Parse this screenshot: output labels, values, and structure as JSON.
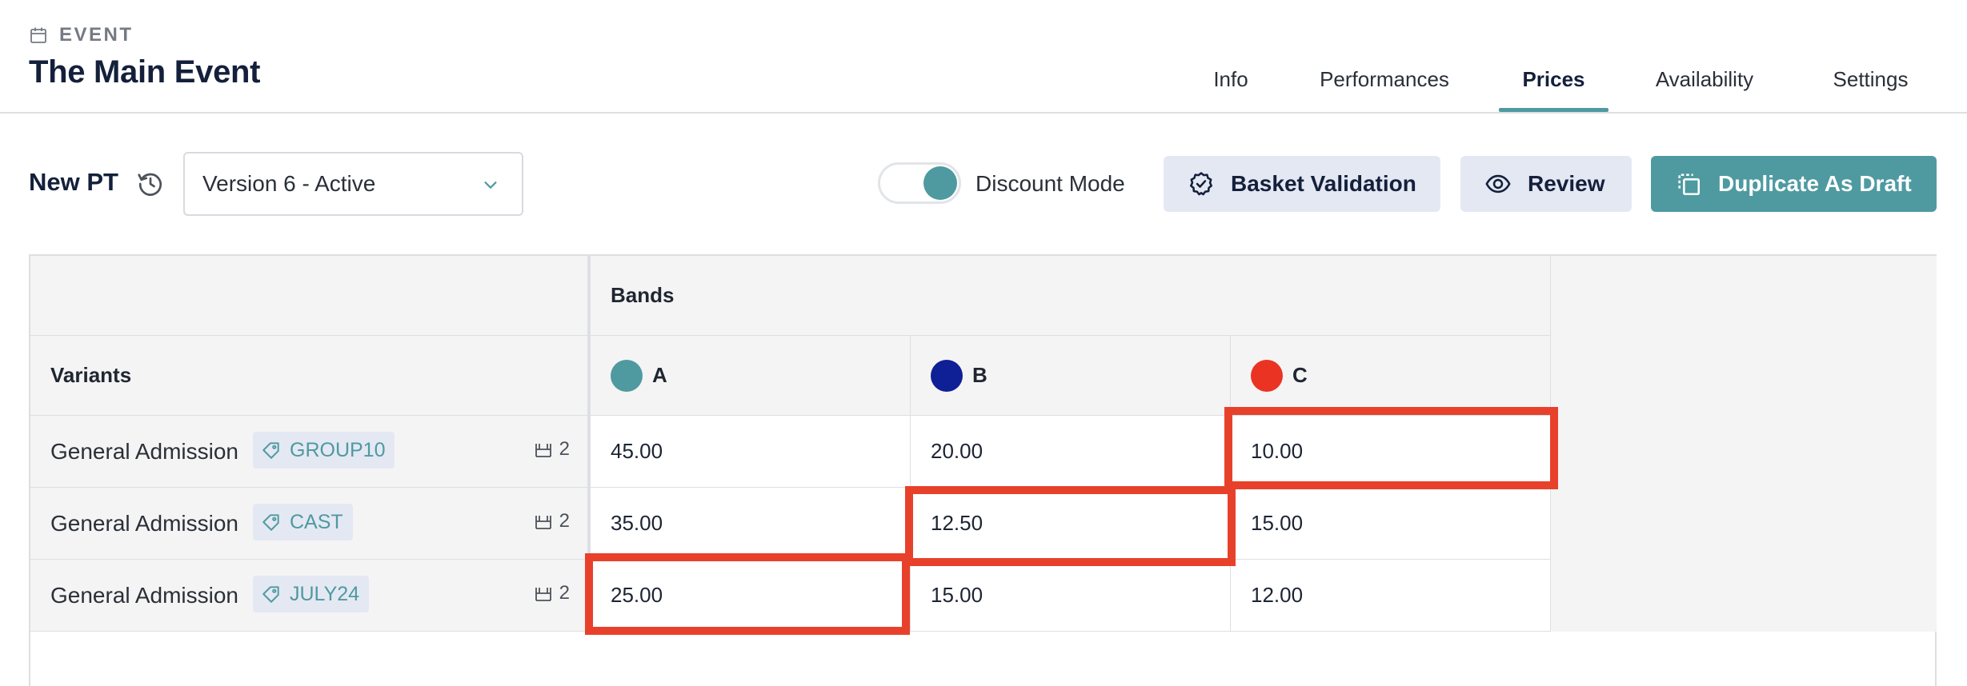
{
  "header": {
    "section_label": "EVENT",
    "title": "The Main Event",
    "tabs": [
      {
        "label": "Info",
        "active": false
      },
      {
        "label": "Performances",
        "active": false
      },
      {
        "label": "Prices",
        "active": true
      },
      {
        "label": "Availability",
        "active": false
      },
      {
        "label": "Settings",
        "active": false
      }
    ]
  },
  "toolbar": {
    "pt_name": "New PT",
    "version_select": {
      "value": "Version 6 - Active"
    },
    "discount_mode": {
      "label": "Discount Mode",
      "on": true
    },
    "buttons": {
      "basket_validation": "Basket Validation",
      "review": "Review",
      "duplicate": "Duplicate As Draft"
    }
  },
  "table": {
    "bands_header": "Bands",
    "variants_header": "Variants",
    "bands": [
      {
        "name": "A",
        "color": "#4e9aa0"
      },
      {
        "name": "B",
        "color": "#0f1f96"
      },
      {
        "name": "C",
        "color": "#ea3323"
      }
    ],
    "rows": [
      {
        "variant": "General Admission",
        "promo": "GROUP10",
        "seats": "2",
        "prices": [
          "45.00",
          "20.00",
          "10.00"
        ]
      },
      {
        "variant": "General Admission",
        "promo": "CAST",
        "seats": "2",
        "prices": [
          "35.00",
          "12.50",
          "15.00"
        ]
      },
      {
        "variant": "General Admission",
        "promo": "JULY24",
        "seats": "2",
        "prices": [
          "25.00",
          "15.00",
          "12.00"
        ]
      }
    ]
  },
  "colors": {
    "accent": "#4e9aa0",
    "title_navy": "#14203b",
    "button_light": "#e4e8f3",
    "highlight_red": "#e8412b"
  }
}
